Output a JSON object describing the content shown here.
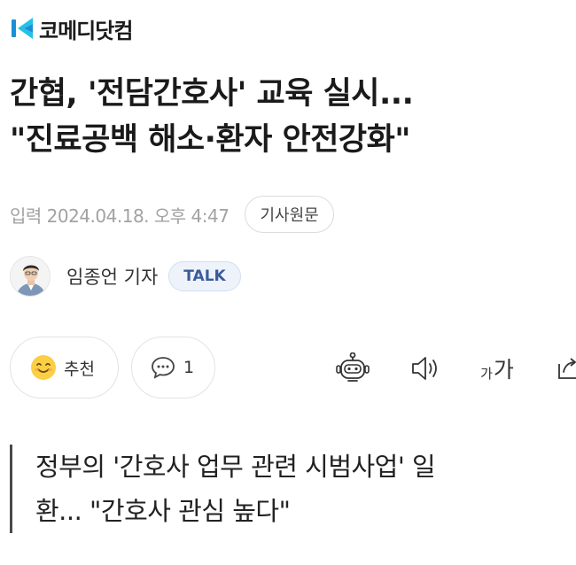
{
  "header": {
    "logo_text": "코메디닷컴"
  },
  "article": {
    "headline_lines": [
      "간협, '전담간호사' 교육 실시...",
      "\"진료공백 해소·환자 안전강화\""
    ],
    "published": "입력 2024.04.18. 오후 4:47",
    "original_article_label": "기사원문",
    "author": {
      "name": "임종언 기자",
      "talk_label": "TALK"
    },
    "subheadline_lines": [
      "정부의 '간호사 업무 관련 시범사업' 일",
      "환... \"간호사 관심 높다\""
    ]
  },
  "actions": {
    "recommend_label": "추천",
    "comment_count": "1",
    "font_size_small": "가",
    "font_size_large": "가"
  },
  "icons": {
    "logo": "komedi-logo-icon",
    "recommend": "smiley-emoji-icon",
    "comment": "speech-bubble-icon",
    "summary": "robot-icon",
    "tts": "speaker-icon",
    "font_size": "font-size-icon",
    "share": "share-icon"
  },
  "colors": {
    "logo_blue": "#1a8fd6",
    "logo_cyan": "#22c2e8",
    "text_gray": "#a2a2a2",
    "talk_text": "#3b5b9a",
    "talk_bg": "#eef3fb",
    "emoji_yellow": "#fbcf45"
  }
}
